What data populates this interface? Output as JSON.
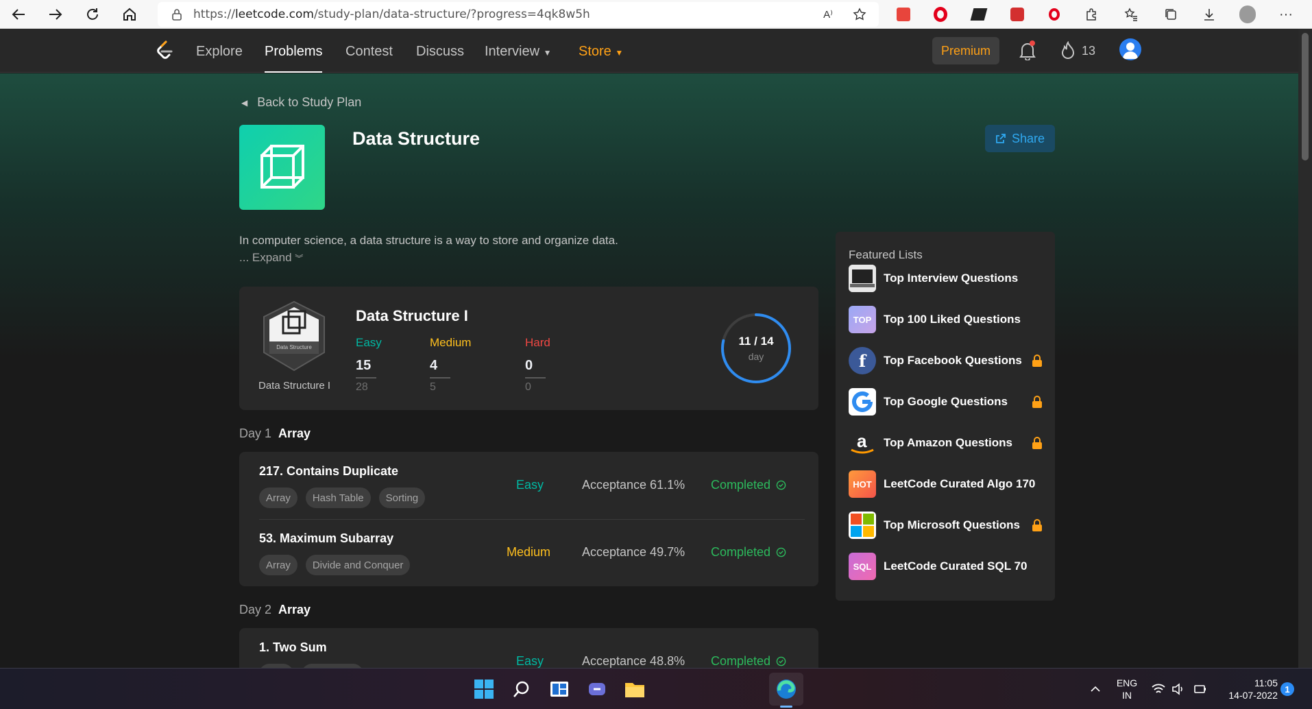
{
  "browser": {
    "url_prefix": "https://",
    "url_domain": "leetcode.com",
    "url_path": "/study-plan/data-structure/?progress=4qk8w5h"
  },
  "nav": {
    "explore": "Explore",
    "problems": "Problems",
    "contest": "Contest",
    "discuss": "Discuss",
    "interview": "Interview",
    "store": "Store",
    "premium": "Premium",
    "streak": "13"
  },
  "hero": {
    "back": "Back to Study Plan",
    "title": "Data Structure",
    "share": "Share",
    "description": "In computer science, a data structure is a way to store and organize data.",
    "expand": "...  Expand"
  },
  "summary": {
    "badge_text": "Data Structure",
    "badge_label": "Data Structure I",
    "title": "Data Structure I",
    "easy_label": "Easy",
    "easy_done": "15",
    "easy_total": "28",
    "medium_label": "Medium",
    "medium_done": "4",
    "medium_total": "5",
    "hard_label": "Hard",
    "hard_done": "0",
    "hard_total": "0",
    "progress_text": "11 / 14",
    "progress_unit": "day",
    "progress_fraction": 0.7857
  },
  "days": [
    {
      "day": "Day 1",
      "topic": "Array",
      "problems": [
        {
          "title": "217. Contains Duplicate",
          "tags": [
            "Array",
            "Hash Table",
            "Sorting"
          ],
          "difficulty": "Easy",
          "acceptance": "Acceptance 61.1%",
          "status": "Completed"
        },
        {
          "title": "53. Maximum Subarray",
          "tags": [
            "Array",
            "Divide and Conquer"
          ],
          "difficulty": "Medium",
          "acceptance": "Acceptance 49.7%",
          "status": "Completed"
        }
      ]
    },
    {
      "day": "Day 2",
      "topic": "Array",
      "problems": [
        {
          "title": "1. Two Sum",
          "difficulty": "Easy",
          "acceptance": "Acceptance 48.8%",
          "status": "Completed"
        }
      ]
    }
  ],
  "featured": {
    "title": "Featured Lists",
    "items": [
      {
        "label": "Top Interview Questions",
        "icon": "laptop-icon",
        "locked": false
      },
      {
        "label": "Top 100 Liked Questions",
        "icon": "top-icon",
        "icon_text": "TOP",
        "locked": false
      },
      {
        "label": "Top Facebook Questions",
        "icon": "facebook-icon",
        "locked": true
      },
      {
        "label": "Top Google Questions",
        "icon": "google-icon",
        "locked": true
      },
      {
        "label": "Top Amazon Questions",
        "icon": "amazon-icon",
        "locked": true
      },
      {
        "label": "LeetCode Curated Algo 170",
        "icon": "hot-icon",
        "icon_text": "HOT",
        "locked": false
      },
      {
        "label": "Top Microsoft Questions",
        "icon": "microsoft-icon",
        "locked": true
      },
      {
        "label": "LeetCode Curated SQL 70",
        "icon": "sql-icon",
        "icon_text": "SQL",
        "locked": false
      }
    ]
  },
  "taskbar": {
    "lang": "ENG",
    "region": "IN",
    "time": "11:05",
    "date": "14-07-2022",
    "notifications": "1"
  },
  "colors": {
    "easy": "#00b8a3",
    "medium": "#ffc01e",
    "hard": "#ef4743",
    "completed": "#2cbb5d",
    "brand": "#ffa116",
    "ring": "#2f8cf0"
  }
}
